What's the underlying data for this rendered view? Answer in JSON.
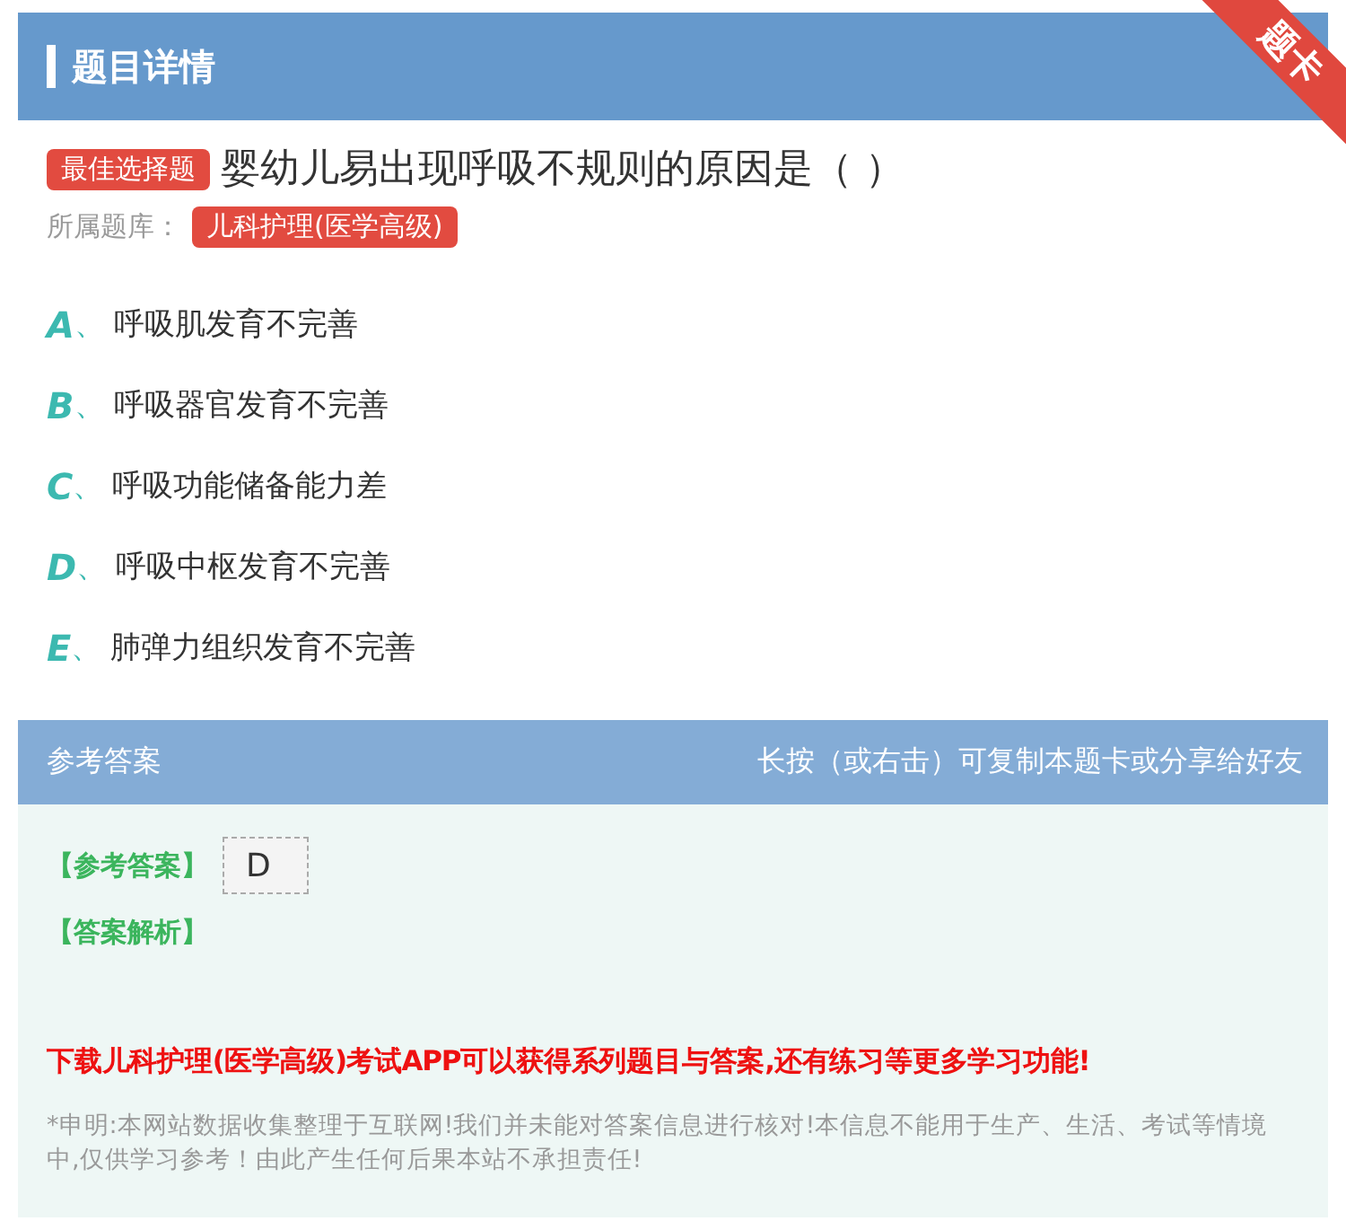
{
  "header": {
    "title": "题目详情",
    "ribbon": "题卡"
  },
  "question": {
    "type_badge": "最佳选择题",
    "text": "婴幼儿易出现呼吸不规则的原因是（  ）",
    "bank_label": "所属题库：",
    "bank": "儿科护理(医学高级)"
  },
  "options": [
    {
      "letter": "A",
      "separator": "、",
      "text": "呼吸肌发育不完善"
    },
    {
      "letter": "B",
      "separator": "、",
      "text": "呼吸器官发育不完善"
    },
    {
      "letter": "C",
      "separator": "、",
      "text": "呼吸功能储备能力差"
    },
    {
      "letter": "D",
      "separator": "、",
      "text": "呼吸中枢发育不完善"
    },
    {
      "letter": "E",
      "separator": "、",
      "text": "肺弹力组织发育不完善"
    }
  ],
  "answer_panel": {
    "title": "参考答案",
    "hint": "长按（或右击）可复制本题卡或分享给好友",
    "answer_label": "【参考答案】",
    "answer": "D",
    "analysis_label": "【答案解析】",
    "promo": "下载儿科护理(医学高级)考试APP可以获得系列题目与答案,还有练习等更多学习功能!",
    "disclaimer": "*申明:本网站数据收集整理于互联网!我们并未能对答案信息进行核对!本信息不能用于生产、生活、考试等情境中,仅供学习参考！由此产生任何后果本站不承担责任!"
  }
}
